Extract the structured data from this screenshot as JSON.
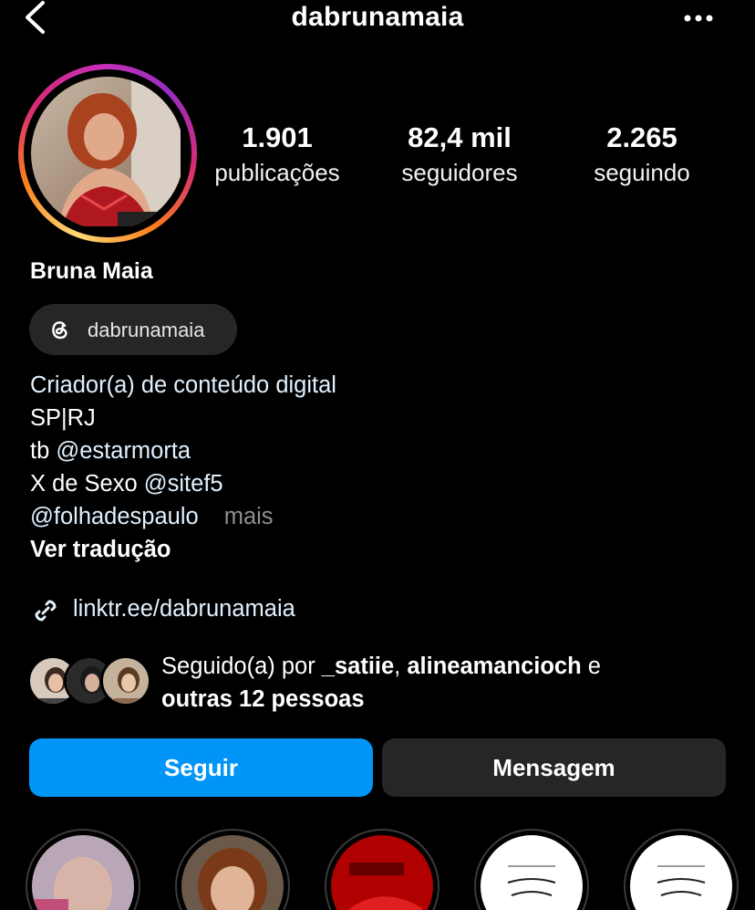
{
  "header": {
    "username": "dabrunamaia",
    "back_icon": "chevron-left-icon",
    "more_icon": "more-horizontal-icon"
  },
  "profile": {
    "stats": [
      {
        "value": "1.901",
        "label": "publicações"
      },
      {
        "value": "82,4 mil",
        "label": "seguidores"
      },
      {
        "value": "2.265",
        "label": "seguindo"
      }
    ],
    "full_name": "Bruna Maia",
    "threads_handle": "dabrunamaia",
    "bio": {
      "category": "Criador(a) de conteúdo digital",
      "line2": "SP|RJ",
      "line3_prefix": "tb ",
      "line3_mention": "@estarmorta",
      "line4_prefix": "X de Sexo ",
      "line4_mention": "@sitef5",
      "line5_mention": "@folhadespaulo",
      "more": "mais",
      "translate": "Ver tradução"
    },
    "link": "linktr.ee/dabrunamaia",
    "followed_by": {
      "prefix": "Seguido(a) por ",
      "user1": "_satiie",
      "separator": ", ",
      "user2": "alineamancioch",
      "conj": " e",
      "others": "outras 12 pessoas"
    }
  },
  "actions": {
    "follow_label": "Seguir",
    "message_label": "Mensagem"
  },
  "colors": {
    "accent_blue": "#0095f6",
    "button_dark": "#262626",
    "link_color": "#e0f1ff",
    "muted": "#8e8e8e"
  }
}
